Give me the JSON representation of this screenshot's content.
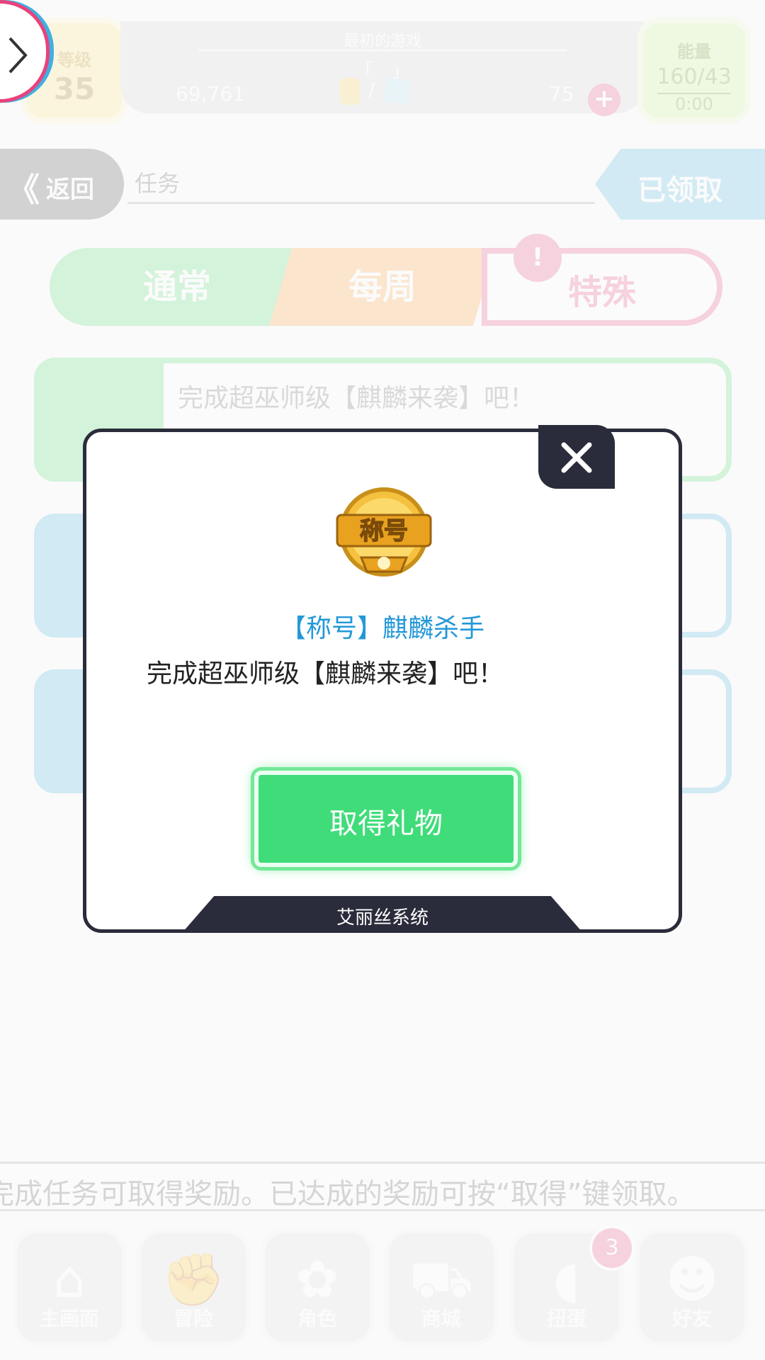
{
  "header": {
    "level_label": "等级",
    "level_value": "35",
    "game_title": "最初的游戏",
    "bracket": "「　」",
    "gold": "69,761",
    "separator": "/",
    "diamonds": "75",
    "plus": "+",
    "energy_label": "能量",
    "energy_value": "160/43",
    "energy_timer": "0:00"
  },
  "nav_bar": {
    "back_arrow": "《",
    "back_label": "返回",
    "section_title": "任务",
    "claimed_label": "已领取"
  },
  "tabs": [
    {
      "label": "通常"
    },
    {
      "label": "每周"
    },
    {
      "label": "特殊",
      "badge": "!"
    }
  ],
  "tasks": [
    {
      "text": "完成超巫师级【麒麟来袭】吧！"
    },
    {
      "text": ""
    },
    {
      "text": ""
    }
  ],
  "hint": "完成任务可取得奖励。已达成的奖励可按“取得”键领取。",
  "bottom_nav": [
    {
      "label": "主画面",
      "icon": "home-icon",
      "glyph": "⌂"
    },
    {
      "label": "冒险",
      "icon": "handshake-icon",
      "glyph": "✊"
    },
    {
      "label": "角色",
      "icon": "bunny-icon",
      "glyph": "✿"
    },
    {
      "label": "商城",
      "icon": "cart-icon",
      "glyph": "⛟"
    },
    {
      "label": "扭蛋",
      "icon": "egg-icon",
      "glyph": "◖",
      "badge": "3"
    },
    {
      "label": "好友",
      "icon": "friends-icon",
      "glyph": "☻"
    }
  ],
  "modal": {
    "reward_name": "【称号】麒麟杀手",
    "reward_desc": "完成超巫师级【麒麟来袭】吧！",
    "claim_button": "取得礼物",
    "footer": "艾丽丝系统",
    "badge_text": "称号"
  },
  "colors": {
    "accent_pink": "#e9427d",
    "accent_green": "#48d86a",
    "accent_blue": "#3fb0e0",
    "accent_orange": "#ff9a2e",
    "modal_dark": "#2b2c3b",
    "reward_blue": "#2398d8"
  }
}
